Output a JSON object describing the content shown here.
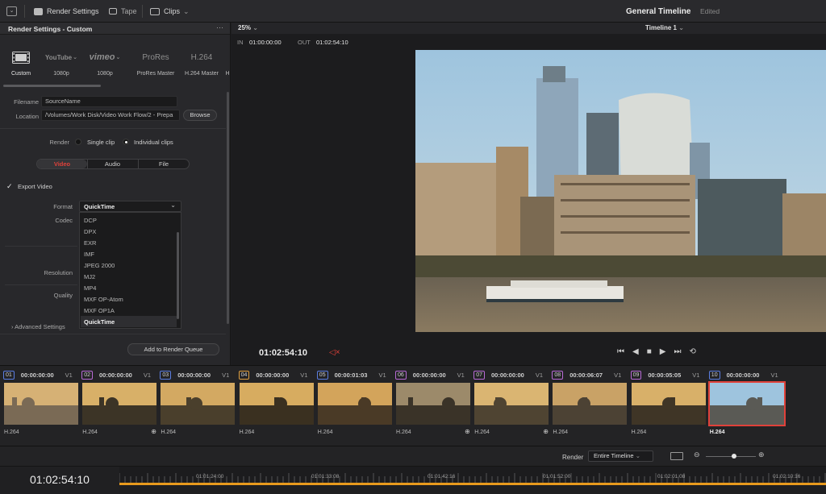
{
  "topbar": {
    "render_settings": "Render Settings",
    "tape": "Tape",
    "clips": "Clips",
    "timeline_title": "General Timeline",
    "edited": "Edited"
  },
  "left_panel": {
    "title": "Render Settings - Custom",
    "more": "···",
    "presets": [
      {
        "logo": "",
        "label": "Custom"
      },
      {
        "logo": "YouTube",
        "label": "1080p"
      },
      {
        "logo": "vimeo",
        "label": "1080p"
      },
      {
        "logo": "ProRes",
        "label": "ProRes Master"
      },
      {
        "logo": "H.264",
        "label": "H.264 Master"
      },
      {
        "logo": "",
        "label": "H"
      }
    ],
    "filename_label": "Filename",
    "filename_value": "SourceName",
    "location_label": "Location",
    "location_value": "/Volumes/Work Disk/Video Work Flow/2 - Prepa",
    "browse": "Browse",
    "render_label": "Render",
    "single_clip": "Single clip",
    "individual_clips": "Individual clips",
    "tabs": [
      "Video",
      "Audio",
      "File"
    ],
    "export_video": "Export Video",
    "format_label": "Format",
    "format_value": "QuickTime",
    "codec_label": "Codec",
    "resolution_label": "Resolution",
    "quality_label": "Quality",
    "format_options": [
      "DCP",
      "DPX",
      "EXR",
      "IMF",
      "JPEG 2000",
      "MJ2",
      "MP4",
      "MXF OP-Atom",
      "MXF OP1A",
      "QuickTime"
    ],
    "advanced": "Advanced Settings",
    "add_queue": "Add to Render Queue"
  },
  "viewer": {
    "zoom": "25%",
    "timeline_name": "Timeline 1",
    "in_label": "IN",
    "in_tc": "01:00:00:00",
    "out_label": "OUT",
    "out_tc": "01:02:54:10",
    "timecode": "01:02:54:10"
  },
  "clips": [
    {
      "num": "01",
      "tc": "00:00:00:00",
      "track": "V1",
      "codec": "H.264",
      "color": "#5a7de0"
    },
    {
      "num": "02",
      "tc": "00:00:00:00",
      "track": "V1",
      "codec": "H.264",
      "color": "#b86bd6"
    },
    {
      "num": "03",
      "tc": "00:00:00:00",
      "track": "V1",
      "codec": "H.264",
      "color": "#5a7de0"
    },
    {
      "num": "04",
      "tc": "00:00:00:00",
      "track": "V1",
      "codec": "H.264",
      "color": "#e0a040"
    },
    {
      "num": "05",
      "tc": "00:00:01:03",
      "track": "V1",
      "codec": "H.264",
      "color": "#5a7de0"
    },
    {
      "num": "06",
      "tc": "00:00:00:00",
      "track": "V1",
      "codec": "H.264",
      "color": "#b86bd6"
    },
    {
      "num": "07",
      "tc": "00:00:00:00",
      "track": "V1",
      "codec": "H.264",
      "color": "#b86bd6"
    },
    {
      "num": "08",
      "tc": "00:00:06:07",
      "track": "V1",
      "codec": "H.264",
      "color": "#b86bd6"
    },
    {
      "num": "09",
      "tc": "00:00:05:05",
      "track": "V1",
      "codec": "H.264",
      "color": "#b86bd6"
    },
    {
      "num": "10",
      "tc": "00:00:00:00",
      "track": "V1",
      "codec": "H.264",
      "color": "#5a7de0"
    }
  ],
  "bottom": {
    "timecode": "01:02:54:10",
    "render_label": "Render",
    "render_value": "Entire Timeline",
    "ruler": [
      "01:01:24:00",
      "01:01:33:08",
      "01:01:42:16",
      "01:01:52:00",
      "01:02:01:08",
      "01:02:10:16"
    ]
  },
  "colors": {
    "accent_red": "#e0413a",
    "playhead": "#e89a1d"
  }
}
